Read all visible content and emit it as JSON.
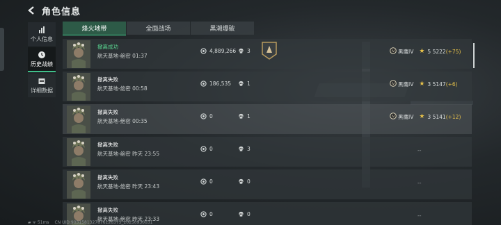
{
  "header": {
    "title": "角色信息"
  },
  "sidebar": {
    "items": [
      {
        "label": "个人信息",
        "icon": "bar-chart-icon"
      },
      {
        "label": "历史战绩",
        "icon": "clock-icon"
      },
      {
        "label": "详细数据",
        "icon": "document-icon"
      }
    ]
  },
  "tabs": [
    "烽火地带",
    "全面战场",
    "黑潮爆破"
  ],
  "matches": [
    {
      "status": "撤离成功",
      "map": "航天基地-绝密 01:37",
      "money": "4,889,266",
      "kills": "3",
      "rank": "黑鹰IV",
      "stars": "5",
      "score": "5222",
      "delta": "(+75)"
    },
    {
      "status": "撤离失败",
      "map": "航天基地-绝密 00:58",
      "money": "186,535",
      "kills": "1",
      "rank": "黑鹰IV",
      "stars": "3",
      "score": "5147",
      "delta": "(+6)"
    },
    {
      "status": "撤离失败",
      "map": "航天基地-绝密 00:35",
      "money": "0",
      "kills": "1",
      "rank": "黑鹰IV",
      "stars": "3",
      "score": "5141",
      "delta": "(+12)"
    },
    {
      "status": "撤离失败",
      "map": "航天基地-绝密 昨天 23:55",
      "money": "0",
      "kills": "3",
      "rank": "--"
    },
    {
      "status": "撤离失败",
      "map": "航天基地-绝密 昨天 23:43",
      "money": "0",
      "kills": "0",
      "rank": "--"
    },
    {
      "status": "撤离失败",
      "map": "航天基地-绝密 昨天 23:33",
      "money": "0",
      "kills": "0",
      "rank": "--"
    }
  ],
  "footer": {
    "ping": "51ms",
    "uid": "CN UID:9031581327876126575_20250930031"
  },
  "colors": {
    "accent": "#46d08f",
    "star": "#e6c14a"
  }
}
